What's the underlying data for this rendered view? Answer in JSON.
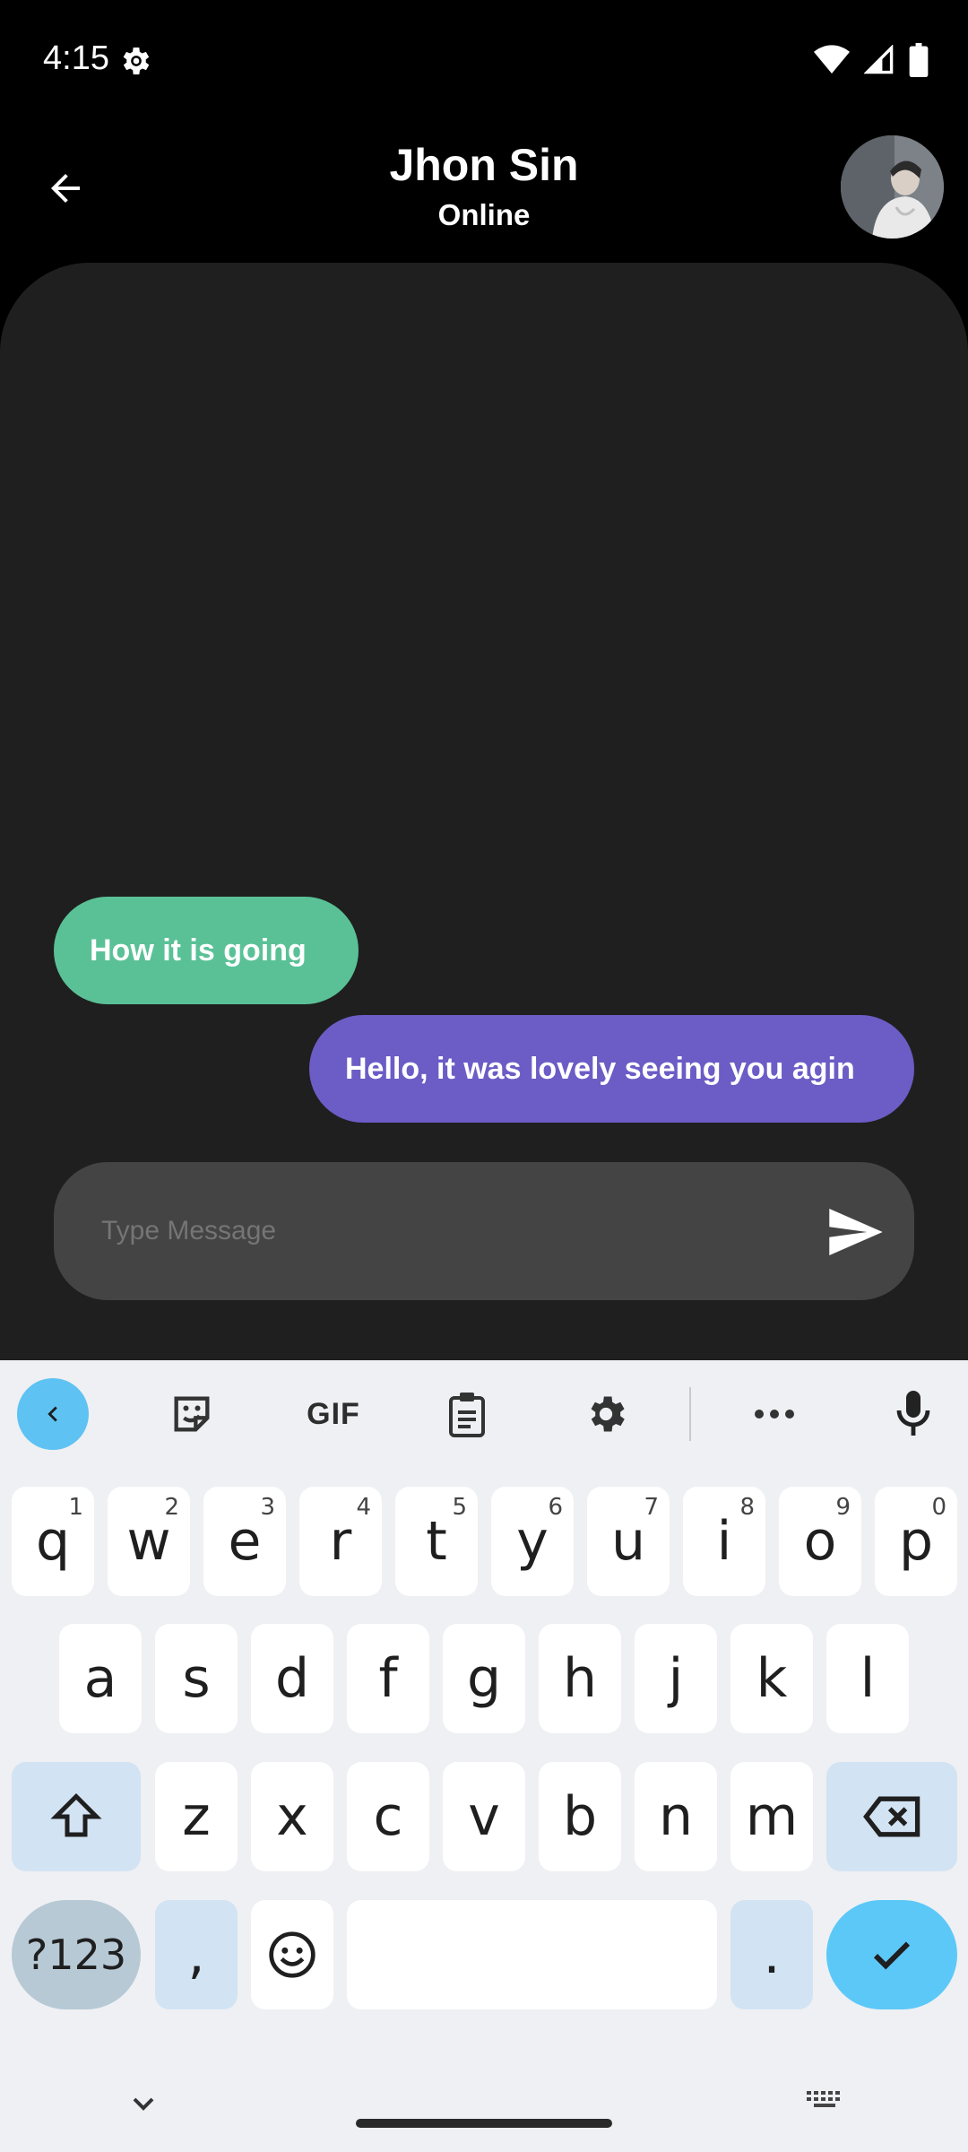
{
  "status_bar": {
    "time": "4:15",
    "icons": [
      "settings-gear-icon",
      "wifi-icon",
      "cell-signal-icon",
      "battery-icon"
    ]
  },
  "header": {
    "contact_name": "Jhon Sin",
    "contact_status": "Online",
    "back_icon": "arrow-left-icon"
  },
  "messages": [
    {
      "direction": "incoming",
      "text": "How it is going",
      "color": "#5ac197"
    },
    {
      "direction": "outgoing",
      "text": "Hello, it was lovely seeing you agin",
      "color": "#6c5cc6"
    }
  ],
  "composer": {
    "placeholder": "Type Message",
    "send_icon": "send-icon"
  },
  "keyboard": {
    "toolbar": {
      "items": [
        "back-chevron-icon",
        "sticker-icon",
        "GIF",
        "clipboard-icon",
        "settings-icon",
        "more-icon",
        "mic-icon"
      ],
      "gif_label": "GIF"
    },
    "row1": [
      {
        "key": "q",
        "hint": "1"
      },
      {
        "key": "w",
        "hint": "2"
      },
      {
        "key": "e",
        "hint": "3"
      },
      {
        "key": "r",
        "hint": "4"
      },
      {
        "key": "t",
        "hint": "5"
      },
      {
        "key": "y",
        "hint": "6"
      },
      {
        "key": "u",
        "hint": "7"
      },
      {
        "key": "i",
        "hint": "8"
      },
      {
        "key": "o",
        "hint": "9"
      },
      {
        "key": "p",
        "hint": "0"
      }
    ],
    "row2": [
      "a",
      "s",
      "d",
      "f",
      "g",
      "h",
      "j",
      "k",
      "l"
    ],
    "row3": [
      "z",
      "x",
      "c",
      "v",
      "b",
      "n",
      "m"
    ],
    "symbols_label": "?123",
    "comma": ",",
    "period": "."
  },
  "colors": {
    "accent_incoming": "#5ac197",
    "accent_outgoing": "#6c5cc6",
    "enter_key": "#5cc8f8"
  }
}
